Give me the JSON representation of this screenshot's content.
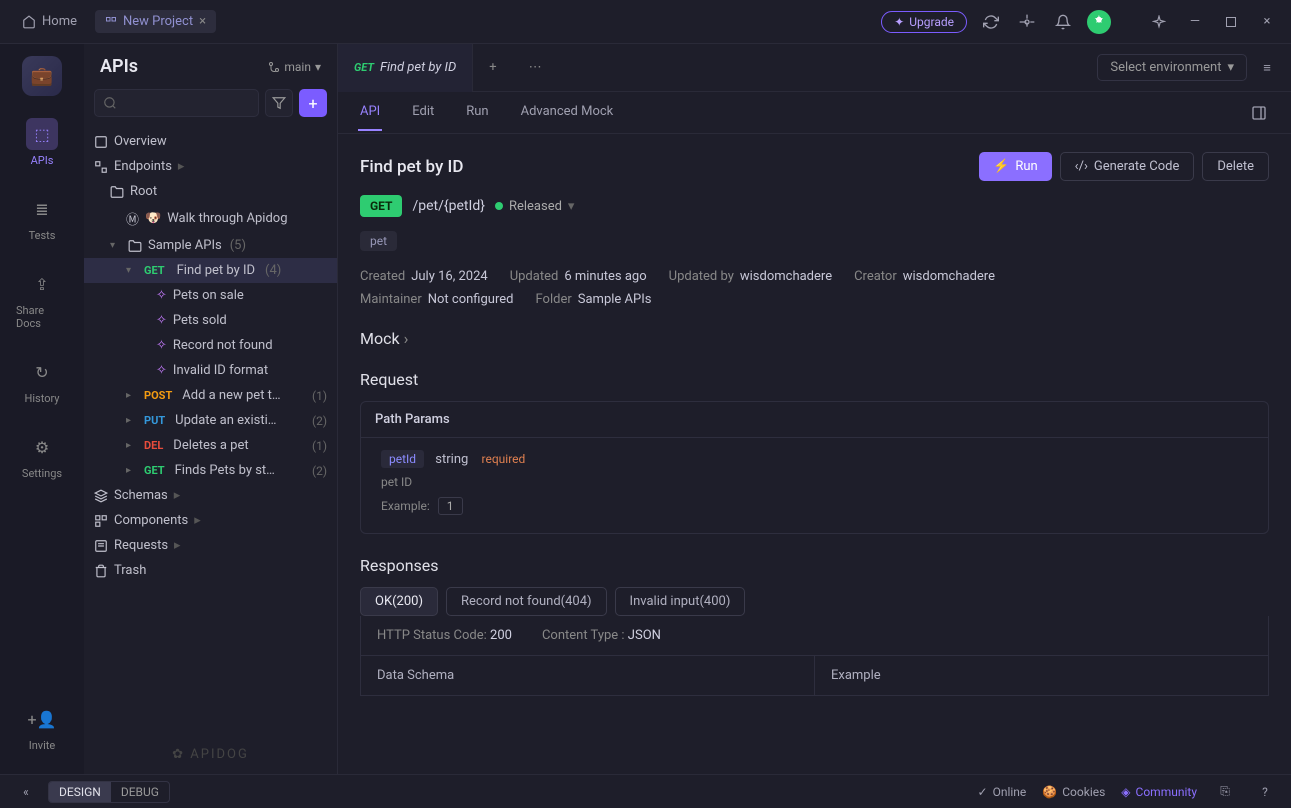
{
  "titlebar": {
    "home": "Home",
    "project_tab": "New Project",
    "upgrade": "Upgrade"
  },
  "iconbar": {
    "apis": "APIs",
    "tests": "Tests",
    "share": "Share Docs",
    "history": "History",
    "settings": "Settings",
    "invite": "Invite"
  },
  "sidebar": {
    "title": "APIs",
    "branch": "main",
    "overview": "Overview",
    "endpoints": "Endpoints",
    "root": "Root",
    "walkthrough": "Walk through Apidog",
    "sample_apis": "Sample APIs",
    "sample_apis_count": "(5)",
    "find_pet": "Find pet by ID",
    "find_pet_count": "(4)",
    "mocks": [
      "Pets on sale",
      "Pets sold",
      "Record not found",
      "Invalid ID format"
    ],
    "endpoints_list": [
      {
        "method": "POST",
        "label": "Add a new pet t…",
        "count": "(1)"
      },
      {
        "method": "PUT",
        "label": "Update an existi…",
        "count": "(2)"
      },
      {
        "method": "DEL",
        "label": "Deletes a pet",
        "count": "(1)"
      },
      {
        "method": "GET",
        "label": "Finds Pets by st…",
        "count": "(2)"
      }
    ],
    "schemas": "Schemas",
    "components": "Components",
    "requests": "Requests",
    "trash": "Trash",
    "brand": "APIDOG"
  },
  "maintab": {
    "method": "GET",
    "title": "Find pet by ID",
    "env": "Select environment"
  },
  "subtabs": [
    "API",
    "Edit",
    "Run",
    "Advanced Mock"
  ],
  "page": {
    "title": "Find pet by ID",
    "run": "Run",
    "gencode": "Generate Code",
    "delete": "Delete",
    "method": "GET",
    "path": "/pet/{petId}",
    "status": "Released",
    "tag": "pet",
    "created_label": "Created",
    "created": "July 16, 2024",
    "updated_label": "Updated",
    "updated": "6 minutes ago",
    "updatedby_label": "Updated by",
    "updatedby": "wisdomchadere",
    "creator_label": "Creator",
    "creator": "wisdomchadere",
    "maintainer_label": "Maintainer",
    "maintainer": "Not configured",
    "folder_label": "Folder",
    "folder": "Sample APIs",
    "mock": "Mock",
    "request": "Request",
    "path_params": "Path Params",
    "param": {
      "name": "petId",
      "type": "string",
      "required": "required",
      "desc": "pet ID",
      "example_label": "Example:",
      "example": "1"
    },
    "responses": "Responses",
    "resp_tabs": [
      "OK(200)",
      "Record not found(404)",
      "Invalid input(400)"
    ],
    "http_code_label": "HTTP Status Code:",
    "http_code": "200",
    "ctype_label": "Content Type :",
    "ctype": "JSON",
    "schema": "Data Schema",
    "example": "Example"
  },
  "footer": {
    "design": "DESIGN",
    "debug": "DEBUG",
    "online": "Online",
    "cookies": "Cookies",
    "community": "Community"
  }
}
